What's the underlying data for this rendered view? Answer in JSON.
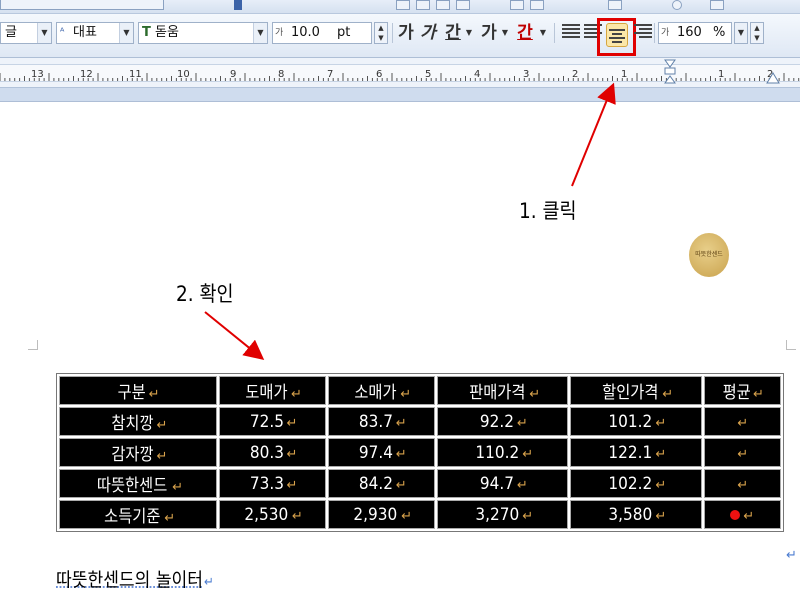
{
  "toolbar": {
    "font_language": "글",
    "style_name": "대표",
    "font_name": "돋움",
    "font_size": "10.0",
    "font_unit": "pt",
    "char_glyphs": [
      "가",
      "가",
      "간",
      "가",
      "간"
    ],
    "line_spacing": "160",
    "line_spacing_unit": "%"
  },
  "ruler": {
    "labels": [
      "13",
      "12",
      "11",
      "10",
      "9",
      "8",
      "7",
      "6",
      "5",
      "4",
      "3",
      "2",
      "1",
      "1",
      "2"
    ]
  },
  "annotations": {
    "step1": "1. 클릭",
    "step2": "2. 확인"
  },
  "stamp": {
    "text": "따뜻한센드"
  },
  "table": {
    "headers": [
      "구분",
      "도매가",
      "소매가",
      "판매가격",
      "할인가격",
      "평균"
    ],
    "rows": [
      [
        "참치깡",
        "72.5",
        "83.7",
        "92.2",
        "101.2",
        ""
      ],
      [
        "감자깡",
        "80.3",
        "97.4",
        "110.2",
        "122.1",
        ""
      ],
      [
        "따뜻한센드",
        "73.3",
        "84.2",
        "94.7",
        "102.2",
        ""
      ],
      [
        "소득기준",
        "2,530",
        "2,930",
        "3,270",
        "3,580",
        ""
      ]
    ]
  },
  "footer": {
    "text": "따뜻한센드의 놀이터"
  },
  "colors": {
    "highlight": "#e00000",
    "annotation_arrow": "#e00000",
    "cell_bg": "#000000",
    "paragraph_mark": "#d8a24c"
  },
  "icons": [
    "align-justify-icon",
    "align-left-icon",
    "align-center-icon",
    "align-right-icon",
    "paragraph-mark-icon"
  ]
}
